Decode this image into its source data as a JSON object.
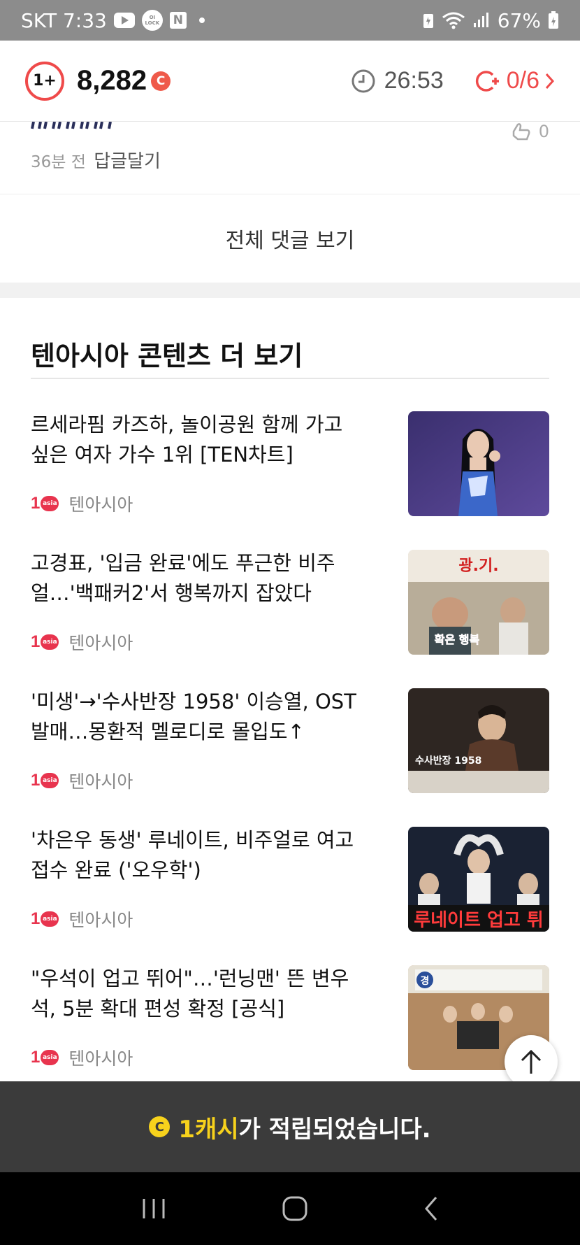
{
  "status_bar": {
    "carrier_time": "SKT 7:33",
    "battery": "67%",
    "lock_text": "OI LOCK",
    "n_badge": "N"
  },
  "header": {
    "level": "1+",
    "points": "8,282",
    "coin_symbol": "C",
    "timer": "26:53",
    "mission": "0/6"
  },
  "comment": {
    "time_ago": "36분 전",
    "reply_label": "답글달기",
    "like_count": "0"
  },
  "all_comments_label": "전체 댓글 보기",
  "section_title": "텐아시아 콘텐츠 더 보기",
  "articles": [
    {
      "title": "르세라핌 카즈하, 놀이공원 함께 가고 싶은 여자 가수 1위 [TEN차트]",
      "source": "텐아시아"
    },
    {
      "title": "고경표, '입금 완료'에도 푸근한 비주얼…'백패커2'서 행복까지 잡았다",
      "source": "텐아시아",
      "thumb_caption": "광.기.",
      "thumb_caption2": "확은 행복"
    },
    {
      "title": "'미생'→'수사반장 1958' 이승열, OST 발매…몽환적 멜로디로 몰입도↑",
      "source": "텐아시아",
      "thumb_caption": "수사반장 1958"
    },
    {
      "title": "'차은우 동생' 루네이트, 비주얼로 여고 접수 완료 ('오우학')",
      "source": "텐아시아",
      "thumb_caption": "루네이트 업고 튀"
    },
    {
      "title": "\"우석이 업고 뛰어\"…'런닝맨' 뜬 변우석, 5분 확대 편성 확정 [공식]",
      "source": "텐아시아",
      "thumb_caption": "경"
    }
  ],
  "source_logo": {
    "digit": "1",
    "inner": "asia"
  },
  "toast": {
    "coin_symbol": "C",
    "highlight": "1캐시",
    "message": "가 적립되었습니다."
  },
  "colors": {
    "accent_red": "#ef4a4a",
    "toast_bg": "#3b3b3b",
    "toast_highlight": "#f7d21c",
    "status_bar": "#8c8c8c"
  }
}
